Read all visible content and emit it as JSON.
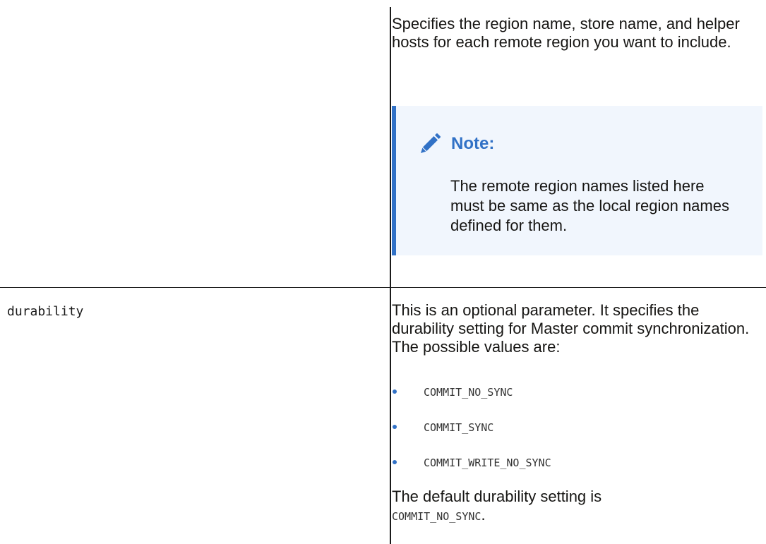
{
  "row1": {
    "description": "Specifies the region name, store name, and helper hosts for each remote region you want to include.",
    "note": {
      "icon": "pencil-icon",
      "title": "Note:",
      "body": "The remote region names listed here must be same as the local region names defined for them."
    }
  },
  "row2": {
    "parameter": "durability",
    "description": "This is an optional parameter. It specifies the durability setting for Master commit synchronization. The possible values are:",
    "values": [
      "COMMIT_NO_SYNC",
      "COMMIT_SYNC",
      "COMMIT_WRITE_NO_SYNC"
    ],
    "default_text": "The default durability setting is",
    "default_value": "COMMIT_NO_SYNC",
    "default_suffix": "."
  },
  "colors": {
    "accent": "#3171c6",
    "note_background": "#f1f6fd",
    "text": "#161513"
  }
}
